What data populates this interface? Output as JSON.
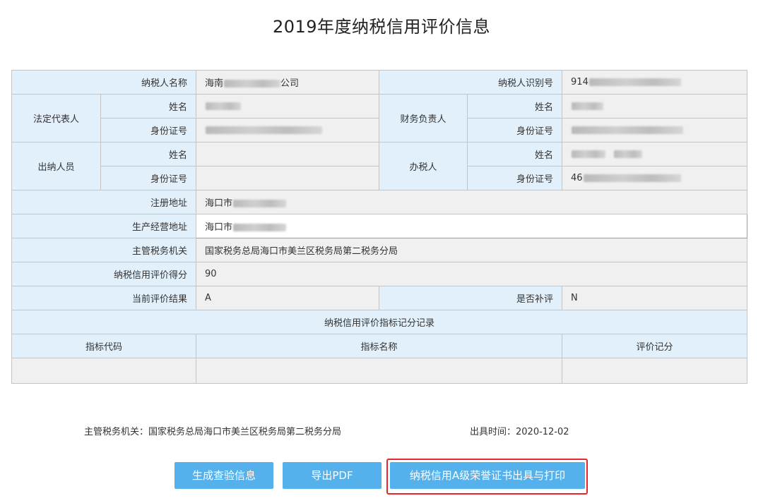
{
  "title": "2019年度纳税信用评价信息",
  "info": {
    "taxpayer_name_label": "纳税人名称",
    "taxpayer_name_value": "海南",
    "taxpayer_name_suffix": "公司",
    "taxpayer_id_label": "纳税人识别号",
    "taxpayer_id_value": "914",
    "legal_rep_label": "法定代表人",
    "finance_head_label": "财务负责人",
    "cashier_label": "出纳人员",
    "tax_agent_label": "办税人",
    "name_label": "姓名",
    "id_card_label": "身份证号",
    "tax_agent_id_value": "46",
    "registered_address_label": "注册地址",
    "registered_address_value": "海口市",
    "business_address_label": "生产经营地址",
    "business_address_value": "海口市",
    "tax_authority_label": "主管税务机关",
    "tax_authority_value": "国家税务总局海口市美兰区税务局第二税务分局",
    "credit_score_label": "纳税信用评价得分",
    "credit_score_value": "90",
    "current_result_label": "当前评价结果",
    "current_result_value": "A",
    "re_evaluation_label": "是否补评",
    "re_evaluation_value": "N",
    "section_title": "纳税信用评价指标记分记录",
    "col_code": "指标代码",
    "col_name": "指标名称",
    "col_score": "评价记分"
  },
  "footer": {
    "authority": "主管税务机关：国家税务总局海口市美兰区税务局第二税务分局",
    "issue_time": "出具时间：2020-12-02"
  },
  "buttons": {
    "generate": "生成查验信息",
    "export_pdf": "导出PDF",
    "certificate": "纳税信用A级荣誉证书出具与打印"
  },
  "colors": {
    "label_bg": "#e2f0fc",
    "value_bg": "#f0f0f0",
    "button_bg": "#55b1ec",
    "highlight": "#e5262b"
  }
}
